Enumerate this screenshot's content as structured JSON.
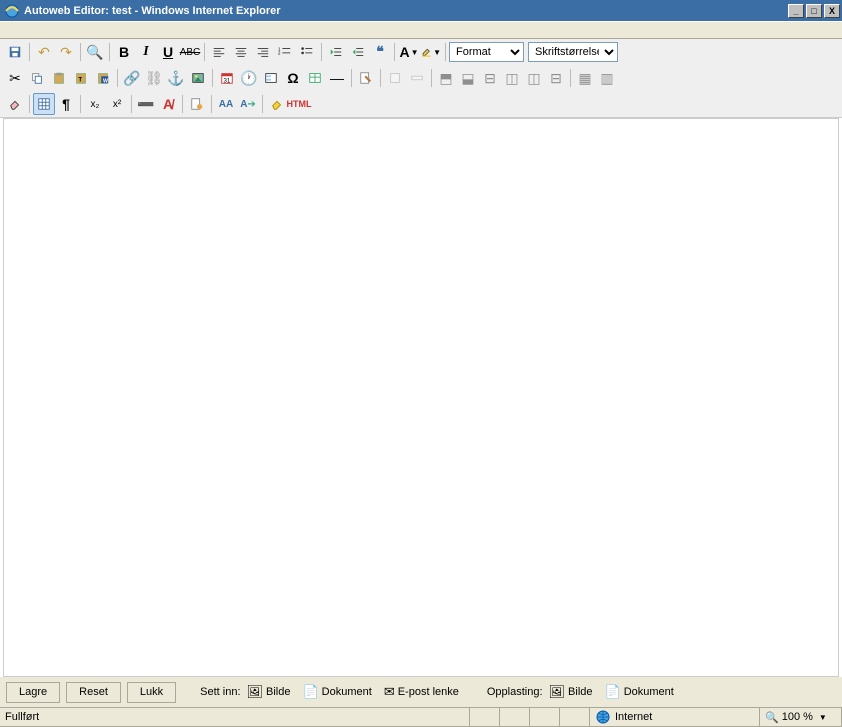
{
  "window": {
    "title": "Autoweb Editor: test - Windows Internet Explorer",
    "min": "_",
    "max": "□",
    "close": "X"
  },
  "toolbar": {
    "format_label": "Format",
    "fontsize_label": "Skriftstørrelse",
    "html_label": "HTML"
  },
  "editor": {
    "content": ""
  },
  "bottom": {
    "save": "Lagre",
    "reset": "Reset",
    "close": "Lukk",
    "insert_label": "Sett inn:",
    "insert_image": "Bilde",
    "insert_doc": "Dokument",
    "insert_email": "E-post lenke",
    "upload_label": "Opplasting:",
    "upload_image": "Bilde",
    "upload_doc": "Dokument"
  },
  "status": {
    "done": "Fullført",
    "zone": "Internet",
    "zoom": "100 %"
  }
}
